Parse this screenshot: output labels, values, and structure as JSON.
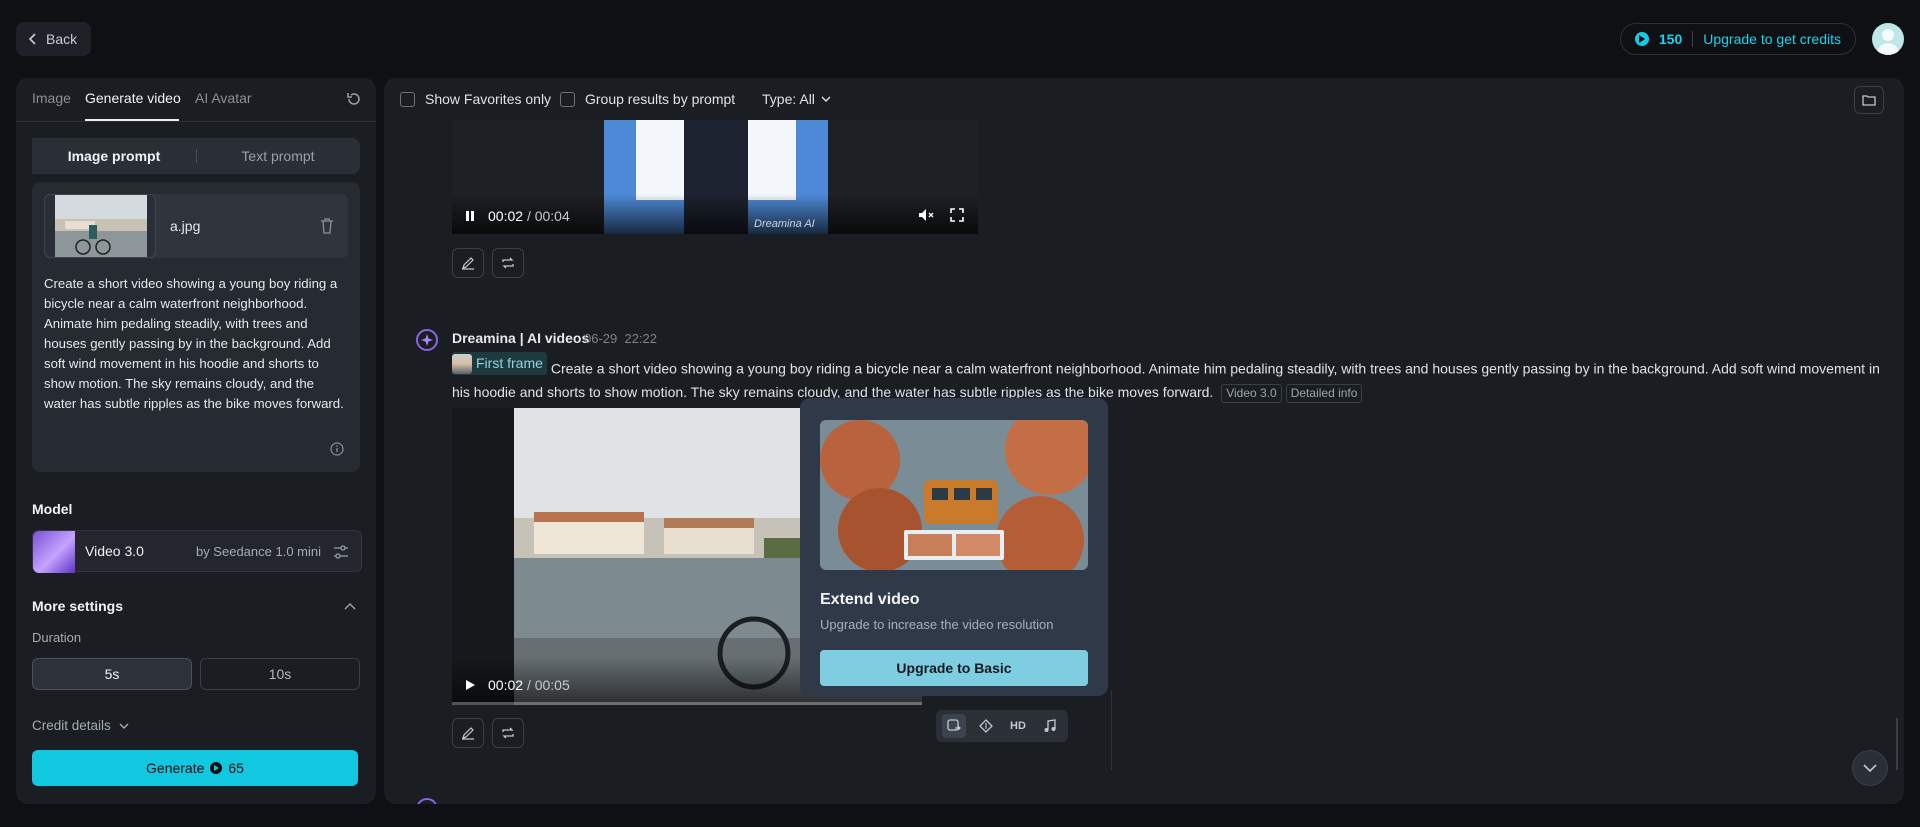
{
  "topbar": {
    "back_label": "Back",
    "credits": "150",
    "upgrade_label": "Upgrade to get credits"
  },
  "left": {
    "tabs": [
      {
        "label": "Image"
      },
      {
        "label": "Generate video"
      },
      {
        "label": "AI Avatar"
      }
    ],
    "prompt_modes": [
      {
        "label": "Image prompt"
      },
      {
        "label": "Text prompt"
      }
    ],
    "file_name": "a.jpg",
    "prompt_text": "Create a short video showing a young boy riding a bicycle near a calm waterfront neighborhood. Animate him pedaling steadily, with trees and houses gently passing by in the background. Add soft wind movement in his hoodie and shorts to show motion. The sky remains cloudy, and the water has subtle ripples as the bike moves forward.",
    "model_title": "Model",
    "model_name": "Video 3.0",
    "model_by": "by Seedance 1.0 mini",
    "more_settings": "More settings",
    "duration_label": "Duration",
    "durations": [
      {
        "label": "5s"
      },
      {
        "label": "10s"
      }
    ],
    "credit_details": "Credit details",
    "generate_label": "Generate",
    "generate_cost": "65"
  },
  "filters": {
    "favorites": "Show Favorites only",
    "group": "Group results by prompt",
    "type": "Type: All"
  },
  "video1": {
    "current": "00:02",
    "total": "/ 00:04",
    "watermark": "Dreamina AI"
  },
  "entry": {
    "name": "Dreamina | AI videos",
    "date": "06-29",
    "time": "22:22",
    "first_frame": "First frame",
    "prompt": "Create a short video showing a young boy riding a bicycle near a calm waterfront neighborhood. Animate him pedaling steadily, with trees and houses gently passing by in the background. Add soft wind movement in his hoodie and shorts to show motion. The sky remains cloudy, and the water has subtle ripples as the bike moves forward.",
    "tag_model": "Video 3.0",
    "tag_info": "Detailed info"
  },
  "video2": {
    "current": "00:02",
    "total": "/ 00:05"
  },
  "popup": {
    "title": "Extend video",
    "subtitle": "Upgrade to increase the video resolution",
    "button": "Upgrade to Basic"
  },
  "tools": {
    "hd_label": "HD"
  },
  "colors": {
    "accent": "#12c8e0",
    "background": "#0f1013",
    "panel": "#1a1d22"
  }
}
